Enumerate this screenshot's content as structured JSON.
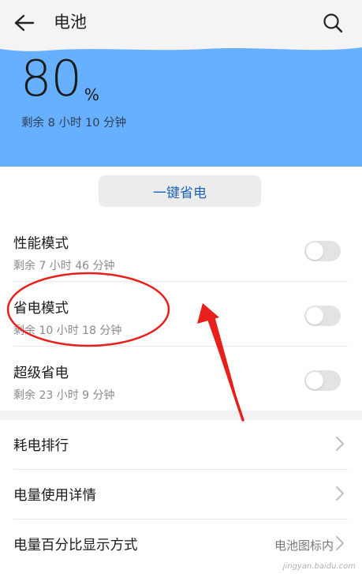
{
  "header": {
    "title": "电池",
    "back_icon": "arrow-left-icon",
    "search_icon": "search-icon"
  },
  "battery": {
    "percent": "80",
    "percent_unit": "%",
    "remaining": "剩余 8 小时 10 分钟",
    "panel_color": "#66b0ff"
  },
  "one_key_save": {
    "label": "一键省电"
  },
  "modes": [
    {
      "name": "性能模式",
      "remaining": "剩余 7 小时 46 分钟",
      "enabled": false
    },
    {
      "name": "省电模式",
      "remaining": "剩余 10 小时 18 分钟",
      "enabled": false
    },
    {
      "name": "超级省电",
      "remaining": "剩余 23 小时 9 分钟",
      "enabled": false
    }
  ],
  "list": [
    {
      "label": "耗电排行",
      "value": ""
    },
    {
      "label": "电量使用详情",
      "value": ""
    },
    {
      "label": "电量百分比显示方式",
      "value": "电池图标内"
    }
  ],
  "watermark": "jingyan.baidu.com",
  "colors": {
    "accent": "#1f63b8",
    "annotation": "#e8201c"
  }
}
